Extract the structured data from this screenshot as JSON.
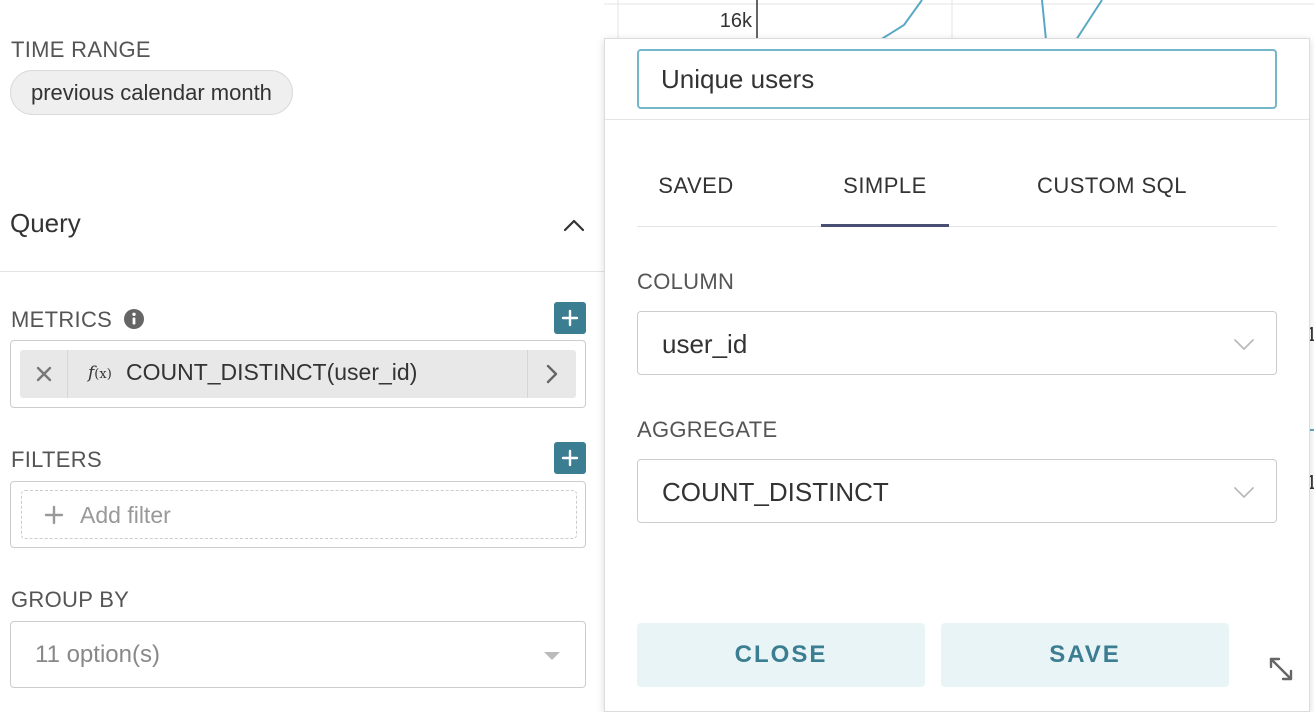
{
  "controls": {
    "time_range": {
      "label": "TIME RANGE",
      "value": "previous calendar month"
    },
    "query": {
      "title": "Query"
    },
    "metrics": {
      "label": "METRICS",
      "chip": {
        "fx": "f",
        "fx_suffix": "(x)",
        "label": "COUNT_DISTINCT(user_id)"
      }
    },
    "filters": {
      "label": "FILTERS",
      "add_label": "Add filter"
    },
    "group_by": {
      "label": "GROUP BY",
      "placeholder": "11 option(s)"
    }
  },
  "chart": {
    "y_tick_label": "16k",
    "series_color": "#5aa9c4",
    "edge_labels": [
      "1",
      "1"
    ]
  },
  "metric_popover": {
    "title_value": "Unique users",
    "tabs": [
      {
        "label": "SAVED",
        "active": false
      },
      {
        "label": "SIMPLE",
        "active": true
      },
      {
        "label": "CUSTOM SQL",
        "active": false
      }
    ],
    "column": {
      "label": "COLUMN",
      "value": "user_id"
    },
    "aggregate": {
      "label": "AGGREGATE",
      "value": "COUNT_DISTINCT"
    },
    "close_label": "CLOSE",
    "save_label": "SAVE"
  },
  "colors": {
    "accent": "#3b7d91",
    "active_tab": "#484f72",
    "input_focus": "#74b7c8"
  }
}
